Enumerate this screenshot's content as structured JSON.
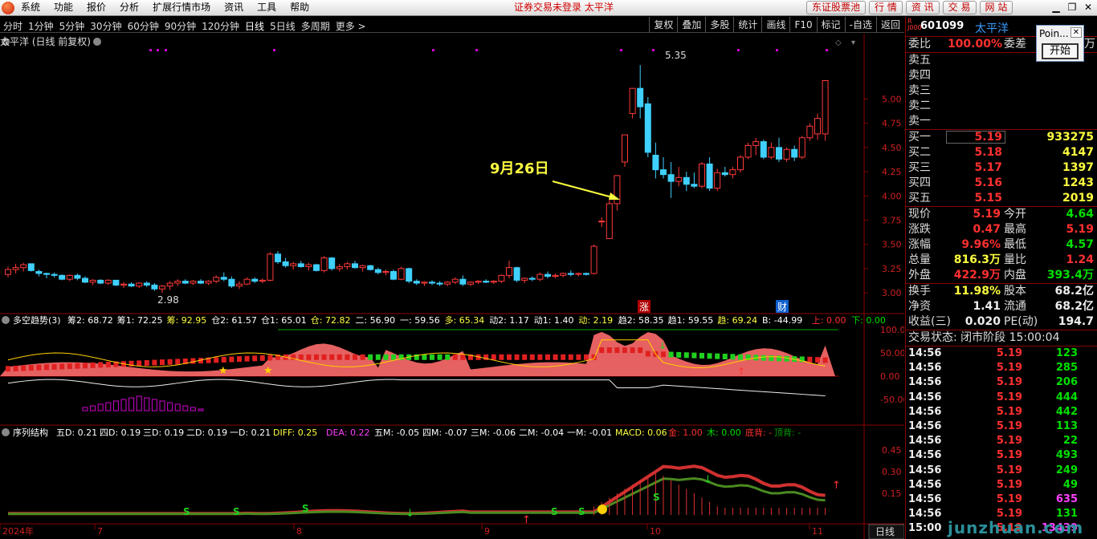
{
  "menubar": {
    "items": [
      "系统",
      "功能",
      "报价",
      "分析",
      "扩展行情市场",
      "资讯",
      "工具",
      "帮助"
    ],
    "status": "证券交易未登录 太平洋",
    "buttons": [
      "东证股票池",
      "行 情",
      "资 讯",
      "交 易",
      "网 站"
    ]
  },
  "toolbar": {
    "periods": [
      "分时",
      "1分钟",
      "5分钟",
      "30分钟",
      "60分钟",
      "90分钟",
      "120分钟",
      "日线",
      "5日线",
      "多周期",
      "更多 >"
    ],
    "active": "日线",
    "tools": [
      "复权",
      "叠加",
      "多股",
      "统计",
      "画线",
      "F10",
      "标记",
      "-自选",
      "返回"
    ]
  },
  "main_chart": {
    "title": "太平洋 (日线 前复权)",
    "high_label": "5.35",
    "low_label": "2.98",
    "annotation": "9月26日",
    "markers": [
      "涨",
      "财"
    ],
    "price_axis": [
      "5.00",
      "4.75",
      "4.50",
      "4.25",
      "4.00",
      "3.75",
      "3.50",
      "3.25",
      "3.00"
    ]
  },
  "indicator1": {
    "name": "多空趋势(3)",
    "values": [
      {
        "t": "筹2: 68.72",
        "c": "#fff"
      },
      {
        "t": "筹1: 72.25",
        "c": "#fff"
      },
      {
        "t": "筹: 92.95",
        "c": "#ffff40"
      },
      {
        "t": "仓2: 61.57",
        "c": "#fff"
      },
      {
        "t": "仓1: 65.01",
        "c": "#fff"
      },
      {
        "t": "仓: 72.82",
        "c": "#ffff40"
      },
      {
        "t": "二: 56.90",
        "c": "#fff"
      },
      {
        "t": "一: 59.56",
        "c": "#fff"
      },
      {
        "t": "多: 65.34",
        "c": "#ffff40"
      },
      {
        "t": "动2: 1.17",
        "c": "#fff"
      },
      {
        "t": "动1: 1.40",
        "c": "#fff"
      },
      {
        "t": "动: 2.19",
        "c": "#ffff40"
      },
      {
        "t": "趋2: 58.35",
        "c": "#fff"
      },
      {
        "t": "趋1: 59.55",
        "c": "#fff"
      },
      {
        "t": "趋: 69.24",
        "c": "#ffff40"
      },
      {
        "t": "B: -44.99",
        "c": "#fff"
      },
      {
        "t": "上: 0.00",
        "c": "#ff3030"
      },
      {
        "t": "下: 0.00",
        "c": "#00e000"
      }
    ],
    "axis": [
      "100.00",
      "50.00",
      "0.00",
      "-50.00"
    ]
  },
  "indicator2": {
    "name": "序列结构",
    "values": [
      {
        "t": "五D: 0.21",
        "c": "#fff"
      },
      {
        "t": "四D: 0.19",
        "c": "#fff"
      },
      {
        "t": "三D: 0.19",
        "c": "#fff"
      },
      {
        "t": "二D: 0.19",
        "c": "#fff"
      },
      {
        "t": "一D: 0.21",
        "c": "#fff"
      },
      {
        "t": "DIFF: 0.25",
        "c": "#ffff40"
      },
      {
        "t": "DEA: 0.22",
        "c": "#ff40ff"
      },
      {
        "t": "五M: -0.05",
        "c": "#fff"
      },
      {
        "t": "四M: -0.07",
        "c": "#fff"
      },
      {
        "t": "三M: -0.06",
        "c": "#fff"
      },
      {
        "t": "二M: -0.04",
        "c": "#fff"
      },
      {
        "t": "一M: -0.01",
        "c": "#fff"
      },
      {
        "t": "MACD: 0.06",
        "c": "#ffff40"
      },
      {
        "t": "金: 1.00",
        "c": "#ff3030"
      },
      {
        "t": "木: 0.00",
        "c": "#00e000"
      },
      {
        "t": "底背: -",
        "c": "#ff3030"
      },
      {
        "t": "顶背: -",
        "c": "#00a000"
      }
    ],
    "axis": [
      "0.45",
      "0.30",
      "0.15"
    ]
  },
  "timeline": {
    "labels": [
      "2024年",
      "7",
      "8",
      "9",
      "10",
      "11"
    ],
    "period_tab": "日线"
  },
  "quote": {
    "code": "601099",
    "name": "太平洋",
    "weibi": {
      "label": "委比",
      "value": "100.00%",
      "diff_label": "委差",
      "unit": "万"
    },
    "sell": [
      "卖五",
      "卖四",
      "卖三",
      "卖二",
      "卖一"
    ],
    "buy": [
      {
        "l": "买一",
        "p": "5.19",
        "v": "933275"
      },
      {
        "l": "买二",
        "p": "5.18",
        "v": "4147"
      },
      {
        "l": "买三",
        "p": "5.17",
        "v": "1397"
      },
      {
        "l": "买四",
        "p": "5.16",
        "v": "1243"
      },
      {
        "l": "买五",
        "p": "5.15",
        "v": "2019"
      }
    ],
    "stats": [
      {
        "l1": "现价",
        "v1": "5.19",
        "c1": "red",
        "l2": "今开",
        "v2": "4.64",
        "c2": "green"
      },
      {
        "l1": "涨跌",
        "v1": "0.47",
        "c1": "red",
        "l2": "最高",
        "v2": "5.19",
        "c2": "red"
      },
      {
        "l1": "涨幅",
        "v1": "9.96%",
        "c1": "red",
        "l2": "最低",
        "v2": "4.57",
        "c2": "green"
      },
      {
        "l1": "总量",
        "v1": "816.3万",
        "c1": "yellow",
        "l2": "量比",
        "v2": "1.24",
        "c2": "red"
      },
      {
        "l1": "外盘",
        "v1": "422.9万",
        "c1": "red",
        "l2": "内盘",
        "v2": "393.4万",
        "c2": "green"
      }
    ],
    "stats2": [
      {
        "l1": "换手",
        "v1": "11.98%",
        "c1": "yellow",
        "l2": "股本",
        "v2": "68.2亿",
        "c2": "white"
      },
      {
        "l1": "净资",
        "v1": "1.41",
        "c1": "white",
        "l2": "流通",
        "v2": "68.2亿",
        "c2": "white"
      },
      {
        "l1": "收益(三)",
        "v1": "0.020",
        "c1": "white",
        "l2": "PE(动)",
        "v2": "194.7",
        "c2": "white"
      }
    ],
    "trade_state": "交易状态: 闭市阶段 15:00:04",
    "ticks": [
      {
        "t": "14:56",
        "p": "5.19",
        "q": "123",
        "c": "green"
      },
      {
        "t": "14:56",
        "p": "5.19",
        "q": "285",
        "c": "green"
      },
      {
        "t": "14:56",
        "p": "5.19",
        "q": "206",
        "c": "green"
      },
      {
        "t": "14:56",
        "p": "5.19",
        "q": "444",
        "c": "green"
      },
      {
        "t": "14:56",
        "p": "5.19",
        "q": "442",
        "c": "green"
      },
      {
        "t": "14:56",
        "p": "5.19",
        "q": "113",
        "c": "green"
      },
      {
        "t": "14:56",
        "p": "5.19",
        "q": "22",
        "c": "green"
      },
      {
        "t": "14:56",
        "p": "5.19",
        "q": "493",
        "c": "green"
      },
      {
        "t": "14:56",
        "p": "5.19",
        "q": "249",
        "c": "green"
      },
      {
        "t": "14:56",
        "p": "5.19",
        "q": "49",
        "c": "green"
      },
      {
        "t": "14:56",
        "p": "5.19",
        "q": "635",
        "c": "magenta"
      },
      {
        "t": "14:56",
        "p": "5.19",
        "q": "131",
        "c": "green"
      },
      {
        "t": "15:00",
        "p": "5.19",
        "q": "13439",
        "c": "magenta"
      }
    ]
  },
  "popup": {
    "title": "Poin...",
    "button": "开始"
  },
  "watermark": "junzhuan.com",
  "chart_data": {
    "type": "candlestick",
    "candles": [
      {
        "o": 3.19,
        "h": 3.27,
        "l": 3.16,
        "c": 3.24
      },
      {
        "o": 3.24,
        "h": 3.3,
        "l": 3.2,
        "c": 3.26
      },
      {
        "o": 3.26,
        "h": 3.31,
        "l": 3.22,
        "c": 3.29
      },
      {
        "o": 3.3,
        "h": 3.3,
        "l": 3.22,
        "c": 3.23
      },
      {
        "o": 3.22,
        "h": 3.24,
        "l": 3.17,
        "c": 3.2
      },
      {
        "o": 3.2,
        "h": 3.21,
        "l": 3.15,
        "c": 3.19
      },
      {
        "o": 3.19,
        "h": 3.21,
        "l": 3.16,
        "c": 3.18
      },
      {
        "o": 3.18,
        "h": 3.19,
        "l": 3.13,
        "c": 3.14
      },
      {
        "o": 3.14,
        "h": 3.19,
        "l": 3.12,
        "c": 3.18
      },
      {
        "o": 3.18,
        "h": 3.2,
        "l": 3.13,
        "c": 3.15
      },
      {
        "o": 3.15,
        "h": 3.17,
        "l": 3.1,
        "c": 3.11
      },
      {
        "o": 3.11,
        "h": 3.14,
        "l": 3.08,
        "c": 3.13
      },
      {
        "o": 3.13,
        "h": 3.14,
        "l": 3.09,
        "c": 3.1
      },
      {
        "o": 3.1,
        "h": 3.14,
        "l": 3.08,
        "c": 3.13
      },
      {
        "o": 3.13,
        "h": 3.13,
        "l": 3.07,
        "c": 3.08
      },
      {
        "o": 3.08,
        "h": 3.11,
        "l": 3.05,
        "c": 3.09
      },
      {
        "o": 3.09,
        "h": 3.11,
        "l": 3.06,
        "c": 3.07
      },
      {
        "o": 3.07,
        "h": 3.11,
        "l": 3.05,
        "c": 3.1
      },
      {
        "o": 3.1,
        "h": 3.12,
        "l": 3.06,
        "c": 3.08
      },
      {
        "o": 3.08,
        "h": 3.1,
        "l": 3.02,
        "c": 3.04
      },
      {
        "o": 3.04,
        "h": 3.08,
        "l": 3.0,
        "c": 3.07
      },
      {
        "o": 3.07,
        "h": 3.12,
        "l": 3.03,
        "c": 3.1
      },
      {
        "o": 3.1,
        "h": 3.14,
        "l": 3.07,
        "c": 3.12
      },
      {
        "o": 3.12,
        "h": 3.14,
        "l": 3.09,
        "c": 3.1
      },
      {
        "o": 3.1,
        "h": 3.13,
        "l": 3.08,
        "c": 3.12
      },
      {
        "o": 3.12,
        "h": 3.14,
        "l": 3.09,
        "c": 3.1
      },
      {
        "o": 3.1,
        "h": 3.13,
        "l": 3.08,
        "c": 3.12
      },
      {
        "o": 3.12,
        "h": 3.18,
        "l": 3.1,
        "c": 3.16
      },
      {
        "o": 3.16,
        "h": 3.21,
        "l": 3.12,
        "c": 3.14
      },
      {
        "o": 3.14,
        "h": 3.17,
        "l": 3.05,
        "c": 3.07
      },
      {
        "o": 3.07,
        "h": 3.12,
        "l": 3.04,
        "c": 3.09
      },
      {
        "o": 3.09,
        "h": 3.16,
        "l": 3.08,
        "c": 3.14
      },
      {
        "o": 3.14,
        "h": 3.16,
        "l": 3.1,
        "c": 3.12
      },
      {
        "o": 3.12,
        "h": 3.15,
        "l": 3.1,
        "c": 3.13
      },
      {
        "o": 3.13,
        "h": 3.42,
        "l": 3.12,
        "c": 3.4
      },
      {
        "o": 3.4,
        "h": 3.43,
        "l": 3.3,
        "c": 3.32
      },
      {
        "o": 3.32,
        "h": 3.36,
        "l": 3.26,
        "c": 3.28
      },
      {
        "o": 3.28,
        "h": 3.32,
        "l": 3.24,
        "c": 3.3
      },
      {
        "o": 3.3,
        "h": 3.33,
        "l": 3.26,
        "c": 3.27
      },
      {
        "o": 3.27,
        "h": 3.31,
        "l": 3.23,
        "c": 3.29
      },
      {
        "o": 3.29,
        "h": 3.3,
        "l": 3.22,
        "c": 3.23
      },
      {
        "o": 3.23,
        "h": 3.38,
        "l": 3.21,
        "c": 3.36
      },
      {
        "o": 3.36,
        "h": 3.37,
        "l": 3.23,
        "c": 3.25
      },
      {
        "o": 3.25,
        "h": 3.3,
        "l": 3.22,
        "c": 3.27
      },
      {
        "o": 3.27,
        "h": 3.32,
        "l": 3.24,
        "c": 3.3
      },
      {
        "o": 3.3,
        "h": 3.33,
        "l": 3.25,
        "c": 3.26
      },
      {
        "o": 3.26,
        "h": 3.29,
        "l": 3.22,
        "c": 3.28
      },
      {
        "o": 3.28,
        "h": 3.29,
        "l": 3.23,
        "c": 3.24
      },
      {
        "o": 3.24,
        "h": 3.26,
        "l": 3.19,
        "c": 3.21
      },
      {
        "o": 3.21,
        "h": 3.24,
        "l": 3.18,
        "c": 3.22
      },
      {
        "o": 3.22,
        "h": 3.24,
        "l": 3.13,
        "c": 3.14
      },
      {
        "o": 3.14,
        "h": 3.27,
        "l": 3.13,
        "c": 3.25
      },
      {
        "o": 3.25,
        "h": 3.26,
        "l": 3.1,
        "c": 3.12
      },
      {
        "o": 3.12,
        "h": 3.14,
        "l": 3.08,
        "c": 3.1
      },
      {
        "o": 3.1,
        "h": 3.12,
        "l": 3.07,
        "c": 3.11
      },
      {
        "o": 3.11,
        "h": 3.13,
        "l": 3.08,
        "c": 3.1
      },
      {
        "o": 3.1,
        "h": 3.12,
        "l": 3.07,
        "c": 3.09
      },
      {
        "o": 3.09,
        "h": 3.12,
        "l": 3.07,
        "c": 3.11
      },
      {
        "o": 3.11,
        "h": 3.16,
        "l": 3.09,
        "c": 3.14
      },
      {
        "o": 3.14,
        "h": 3.18,
        "l": 3.07,
        "c": 3.09
      },
      {
        "o": 3.09,
        "h": 3.12,
        "l": 3.07,
        "c": 3.11
      },
      {
        "o": 3.11,
        "h": 3.13,
        "l": 3.09,
        "c": 3.12
      },
      {
        "o": 3.12,
        "h": 3.14,
        "l": 3.1,
        "c": 3.11
      },
      {
        "o": 3.11,
        "h": 3.13,
        "l": 3.09,
        "c": 3.12
      },
      {
        "o": 3.12,
        "h": 3.19,
        "l": 3.1,
        "c": 3.18
      },
      {
        "o": 3.18,
        "h": 3.33,
        "l": 3.15,
        "c": 3.26
      },
      {
        "o": 3.26,
        "h": 3.27,
        "l": 3.11,
        "c": 3.13
      },
      {
        "o": 3.13,
        "h": 3.16,
        "l": 3.1,
        "c": 3.15
      },
      {
        "o": 3.15,
        "h": 3.17,
        "l": 3.12,
        "c": 3.14
      },
      {
        "o": 3.14,
        "h": 3.21,
        "l": 3.12,
        "c": 3.19
      },
      {
        "o": 3.19,
        "h": 3.22,
        "l": 3.15,
        "c": 3.17
      },
      {
        "o": 3.17,
        "h": 3.2,
        "l": 3.15,
        "c": 3.18
      },
      {
        "o": 3.18,
        "h": 3.21,
        "l": 3.16,
        "c": 3.2
      },
      {
        "o": 3.2,
        "h": 3.23,
        "l": 3.17,
        "c": 3.19
      },
      {
        "o": 3.19,
        "h": 3.21,
        "l": 3.17,
        "c": 3.2
      },
      {
        "o": 3.2,
        "h": 3.21,
        "l": 3.18,
        "c": 3.19
      },
      {
        "o": 3.2,
        "h": 3.5,
        "l": 3.19,
        "c": 3.48
      },
      {
        "o": 3.74,
        "h": 3.78,
        "l": 3.68,
        "c": 3.74
      },
      {
        "o": 3.56,
        "h": 3.96,
        "l": 3.56,
        "c": 3.92
      },
      {
        "o": 3.92,
        "h": 4.21,
        "l": 3.85,
        "c": 4.21
      },
      {
        "o": 4.35,
        "h": 4.63,
        "l": 4.3,
        "c": 4.63
      },
      {
        "o": 4.85,
        "h": 5.11,
        "l": 4.8,
        "c": 5.11
      },
      {
        "o": 5.11,
        "h": 5.35,
        "l": 4.8,
        "c": 4.92
      },
      {
        "o": 4.95,
        "h": 5.02,
        "l": 4.4,
        "c": 4.45
      },
      {
        "o": 4.42,
        "h": 4.55,
        "l": 4.18,
        "c": 4.27
      },
      {
        "o": 4.27,
        "h": 4.4,
        "l": 4.18,
        "c": 4.22
      },
      {
        "o": 4.22,
        "h": 4.35,
        "l": 3.98,
        "c": 4.15
      },
      {
        "o": 4.15,
        "h": 4.3,
        "l": 4.1,
        "c": 4.19
      },
      {
        "o": 4.19,
        "h": 4.25,
        "l": 4.05,
        "c": 4.12
      },
      {
        "o": 4.12,
        "h": 4.24,
        "l": 4.08,
        "c": 4.1
      },
      {
        "o": 4.1,
        "h": 4.35,
        "l": 4.08,
        "c": 4.33
      },
      {
        "o": 4.33,
        "h": 4.4,
        "l": 4.05,
        "c": 4.08
      },
      {
        "o": 4.08,
        "h": 4.28,
        "l": 4.05,
        "c": 4.24
      },
      {
        "o": 4.24,
        "h": 4.3,
        "l": 4.2,
        "c": 4.22
      },
      {
        "o": 4.22,
        "h": 4.3,
        "l": 4.18,
        "c": 4.27
      },
      {
        "o": 4.27,
        "h": 4.42,
        "l": 4.24,
        "c": 4.4
      },
      {
        "o": 4.4,
        "h": 4.55,
        "l": 4.38,
        "c": 4.52
      },
      {
        "o": 4.52,
        "h": 4.6,
        "l": 4.42,
        "c": 4.56
      },
      {
        "o": 4.56,
        "h": 4.58,
        "l": 4.38,
        "c": 4.4
      },
      {
        "o": 4.4,
        "h": 4.55,
        "l": 4.38,
        "c": 4.5
      },
      {
        "o": 4.5,
        "h": 4.6,
        "l": 4.35,
        "c": 4.38
      },
      {
        "o": 4.38,
        "h": 4.5,
        "l": 4.35,
        "c": 4.48
      },
      {
        "o": 4.48,
        "h": 4.52,
        "l": 4.36,
        "c": 4.4
      },
      {
        "o": 4.4,
        "h": 4.62,
        "l": 4.38,
        "c": 4.6
      },
      {
        "o": 4.6,
        "h": 4.75,
        "l": 4.57,
        "c": 4.72
      },
      {
        "o": 4.64,
        "h": 4.85,
        "l": 4.58,
        "c": 4.8
      },
      {
        "o": 4.64,
        "h": 5.19,
        "l": 4.57,
        "c": 5.19
      }
    ]
  }
}
